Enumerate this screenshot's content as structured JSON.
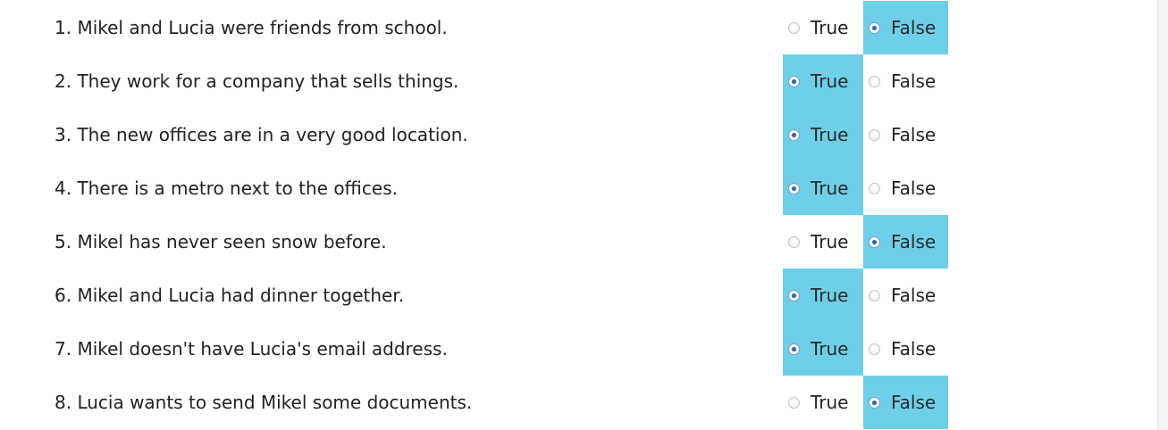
{
  "options": {
    "true_label": "True",
    "false_label": "False"
  },
  "questions": [
    {
      "text": "1. Mikel and Lucia were friends from school.",
      "selected": "False"
    },
    {
      "text": "2. They work for a company that sells things.",
      "selected": "True"
    },
    {
      "text": "3. The new offices are in a very good location.",
      "selected": "True"
    },
    {
      "text": "4. There is a metro next to the offices.",
      "selected": "True"
    },
    {
      "text": "5. Mikel has never seen snow before.",
      "selected": "False"
    },
    {
      "text": "6. Mikel and Lucia had dinner together.",
      "selected": "True"
    },
    {
      "text": "7. Mikel doesn't have Lucia's email address.",
      "selected": "True"
    },
    {
      "text": "8. Lucia wants to send Mikel some documents.",
      "selected": "False"
    }
  ],
  "colors": {
    "selected_bg": "#6fcfe8",
    "text": "#222222"
  }
}
